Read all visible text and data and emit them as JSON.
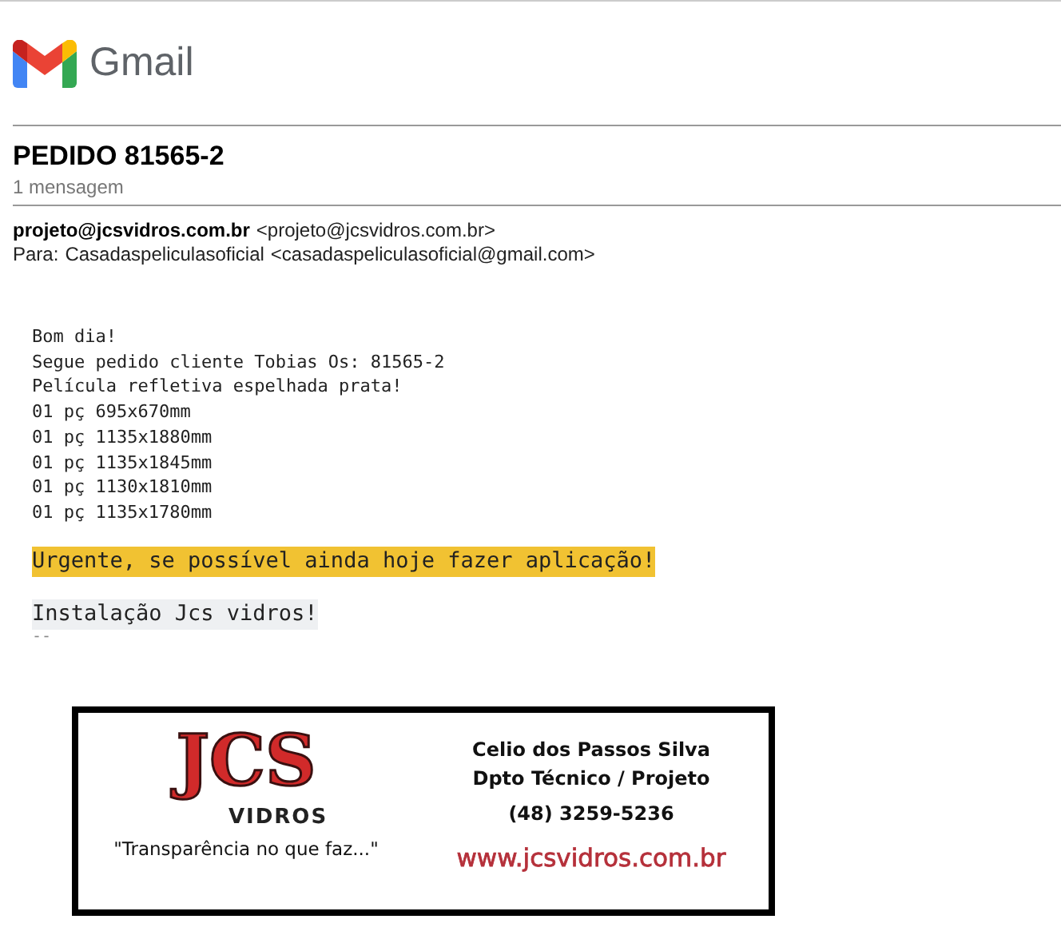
{
  "app": {
    "name": "Gmail"
  },
  "thread": {
    "subject": "PEDIDO 81565-2",
    "count": "1 mensagem"
  },
  "message": {
    "from_name": "projeto@jcsvidros.com.br",
    "from_address": "<projeto@jcsvidros.com.br>",
    "to_label": "Para:",
    "to_name": "Casadaspeliculasoficial",
    "to_address": "<casadaspeliculasoficial@gmail.com>",
    "body": [
      {
        "kind": "plain",
        "text": "Bom dia!"
      },
      {
        "kind": "plain",
        "text": "Segue pedido cliente Tobias Os: 81565-2"
      },
      {
        "kind": "plain",
        "text": "Película refletiva espelhada prata!"
      },
      {
        "kind": "plain",
        "text": "01 pç 695x670mm"
      },
      {
        "kind": "plain",
        "text": "01 pç 1135x1880mm"
      },
      {
        "kind": "plain",
        "text": "01 pç 1135x1845mm"
      },
      {
        "kind": "plain",
        "text": "01 pç 1130x1810mm"
      },
      {
        "kind": "plain",
        "text": "01 pç 1135x1780mm"
      },
      {
        "kind": "highlight",
        "text": "Urgente, se possível ainda hoje fazer aplicação!"
      },
      {
        "kind": "shaded",
        "text": "Instalação Jcs vidros!"
      }
    ],
    "separator": "--",
    "signature": {
      "logo": "JCS",
      "logo_sub": "VIDROS",
      "slogan": "\"Transparência no que faz...\"",
      "name": "Celio dos Passos Silva",
      "role": "Dpto Técnico / Projeto",
      "phone": "(48) 3259-5236",
      "website": "www.jcsvidros.com.br"
    }
  }
}
